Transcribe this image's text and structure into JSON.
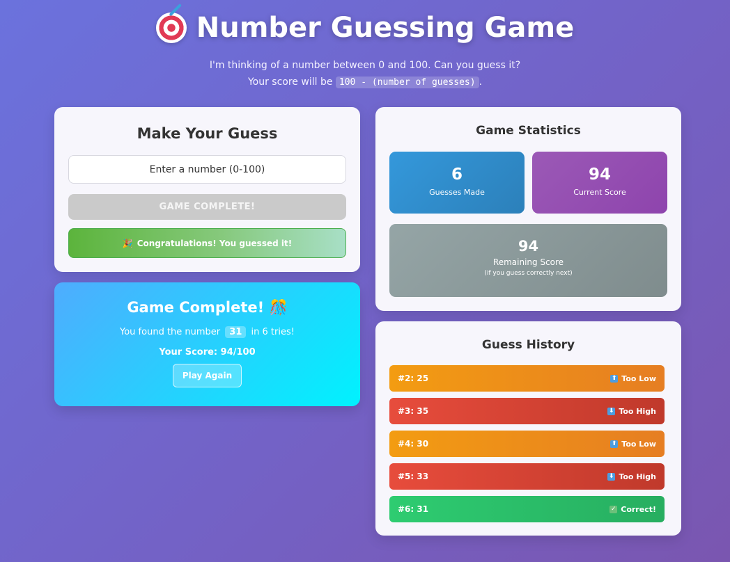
{
  "header": {
    "title": "Number Guessing Game",
    "title_icon": "dart-target-icon",
    "subtitle_before": "I'm thinking of a number between 0 and 100. Can you guess it? Your score will be",
    "subtitle_code": "100 - (number of guesses)",
    "subtitle_after": "."
  },
  "guess_panel": {
    "title": "Make Your Guess",
    "input_placeholder": "Enter a number (0-100)",
    "button_label": "GAME COMPLETE!",
    "success_message": "Congratulations! You guessed it!"
  },
  "complete_panel": {
    "title": "Game Complete!",
    "found_before": "You found the number",
    "number": "31",
    "found_after": "in 6 tries!",
    "score_text": "Your Score: 94/100",
    "play_again_label": "Play Again"
  },
  "stats": {
    "title": "Game Statistics",
    "guesses_made": {
      "value": "6",
      "label": "Guesses Made"
    },
    "current_score": {
      "value": "94",
      "label": "Current Score"
    },
    "remaining_score": {
      "value": "94",
      "label": "Remaining Score",
      "note": "(if you guess correctly next)"
    }
  },
  "history": {
    "title": "Guess History",
    "items": [
      {
        "label": "#2: 25",
        "hint": "Too Low",
        "status": "low",
        "icon": "arrow-up-icon"
      },
      {
        "label": "#3: 35",
        "hint": "Too High",
        "status": "high",
        "icon": "arrow-down-icon"
      },
      {
        "label": "#4: 30",
        "hint": "Too Low",
        "status": "low",
        "icon": "arrow-up-icon"
      },
      {
        "label": "#5: 33",
        "hint": "Too High",
        "status": "high",
        "icon": "arrow-down-icon"
      },
      {
        "label": "#6: 31",
        "hint": "Correct!",
        "status": "correct",
        "icon": "checkmark-icon"
      }
    ]
  },
  "colors": {
    "background_start": "#6b72dd",
    "background_end": "#7a56b0",
    "too_low": "#f39c12",
    "too_high": "#e74c3c",
    "correct": "#2ecc71",
    "stat_blue": "#3498db",
    "stat_purple": "#9b59b6",
    "stat_gray": "#95a5a6"
  }
}
